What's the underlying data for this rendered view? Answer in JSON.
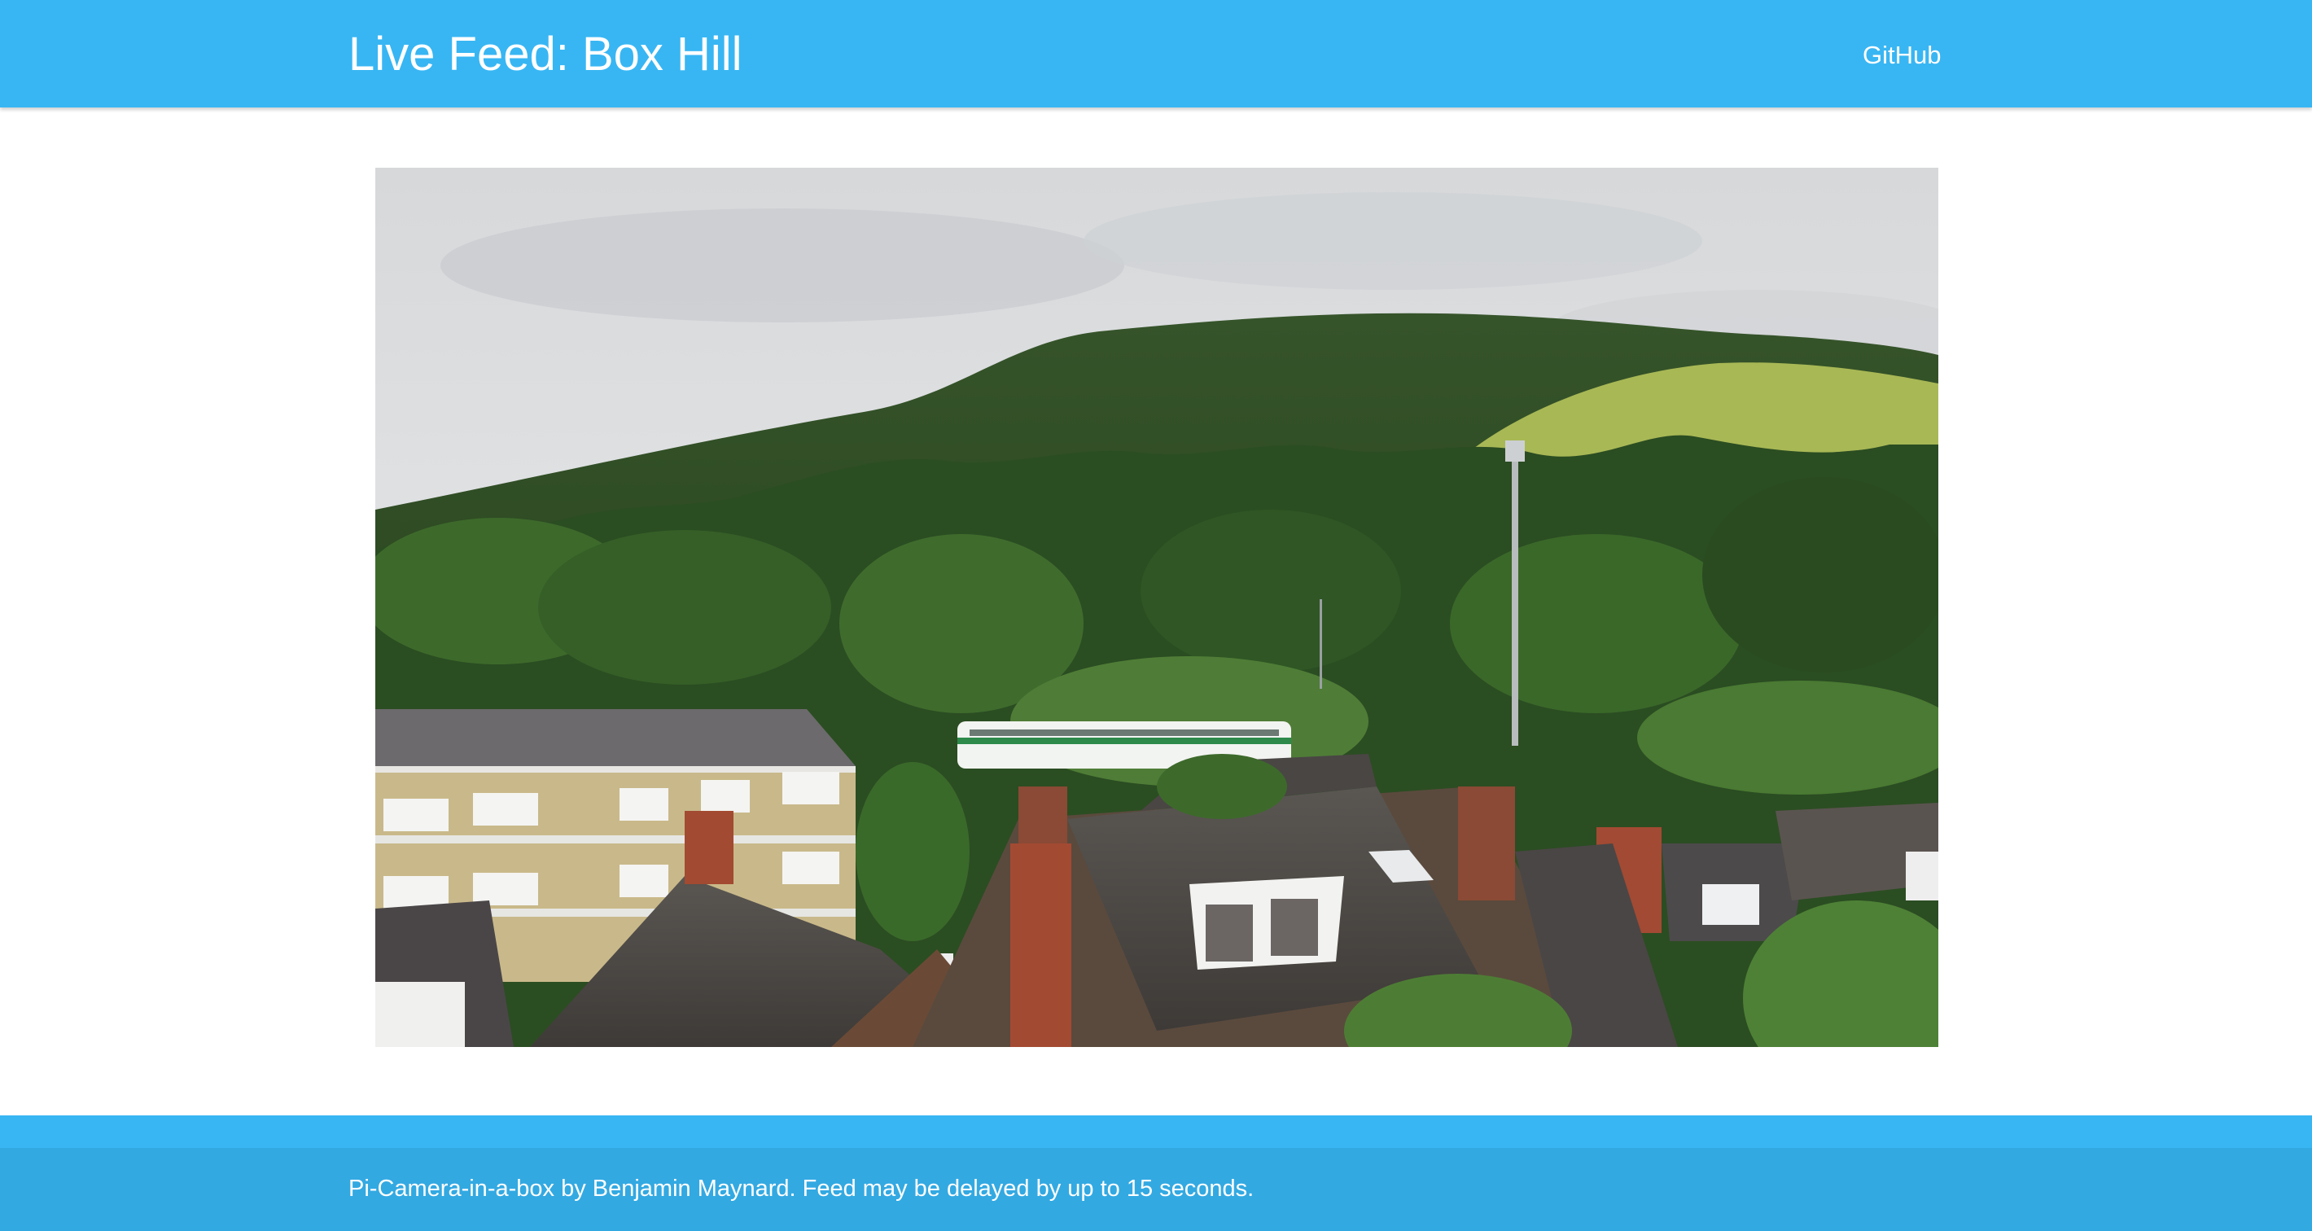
{
  "header": {
    "title": "Live Feed: Box Hill",
    "nav_link": "GitHub"
  },
  "feed": {
    "alt": "Live camera view of Box Hill over rooftops"
  },
  "footer": {
    "text": "Pi-Camera-in-a-box by Benjamin Maynard. Feed may be delayed by up to 15 seconds."
  },
  "colors": {
    "header_bg": "#38b6f3",
    "footer_bg": "#33a9e2",
    "text": "#ffffff"
  }
}
